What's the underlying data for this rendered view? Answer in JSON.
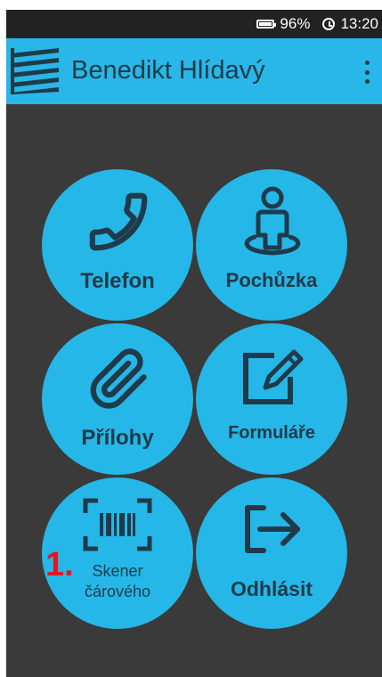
{
  "status": {
    "battery": "96%",
    "time": "13:20"
  },
  "header": {
    "title": "Benedikt Hlídavý"
  },
  "tiles": [
    {
      "label": "Telefon",
      "icon": "phone-icon"
    },
    {
      "label": "Pochůzka",
      "icon": "person-location-icon"
    },
    {
      "label": "Přílohy",
      "icon": "paperclip-icon"
    },
    {
      "label": "Formuláře",
      "icon": "edit-form-icon"
    },
    {
      "label_line1": "Skener",
      "label_line2": "čárového",
      "icon": "barcode-scanner-icon"
    },
    {
      "label": "Odhlásit",
      "icon": "logout-icon"
    }
  ],
  "annotation": {
    "text": "1."
  },
  "colors": {
    "accent": "#29b6e8",
    "background": "#3a3a3a",
    "text_dark": "#1f3b49",
    "annotation": "#e8141c"
  }
}
